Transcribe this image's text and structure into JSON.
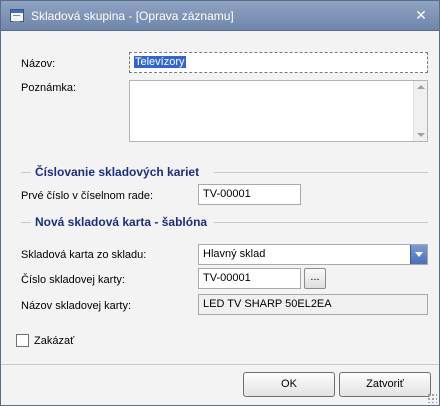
{
  "window": {
    "title": "Skladová skupina - [Oprava záznamu]",
    "close_glyph": "✕"
  },
  "fields": {
    "nazov_label": "Názov:",
    "nazov_value": "Televízory",
    "poznamka_label": "Poznámka:",
    "poznamka_value": ""
  },
  "sections": {
    "numbering": "Číslovanie skladových kariet",
    "template": "Nová skladová karta - šablóna"
  },
  "numbering": {
    "first_number_label": "Prvé číslo v číselnom rade:",
    "first_number_value": "TV-00001"
  },
  "template": {
    "warehouse_label": "Skladová karta zo skladu:",
    "warehouse_value": "Hlavný sklad",
    "card_number_label": "Číslo skladovej karty:",
    "card_number_value": "TV-00001",
    "browse_label": "...",
    "card_name_label": "Názov skladovej karty:",
    "card_name_value": "LED TV SHARP 50EL2EA"
  },
  "disabled": {
    "label": "Zakázať",
    "checked": false
  },
  "buttons": {
    "ok": "OK",
    "close": "Zatvoriť"
  }
}
